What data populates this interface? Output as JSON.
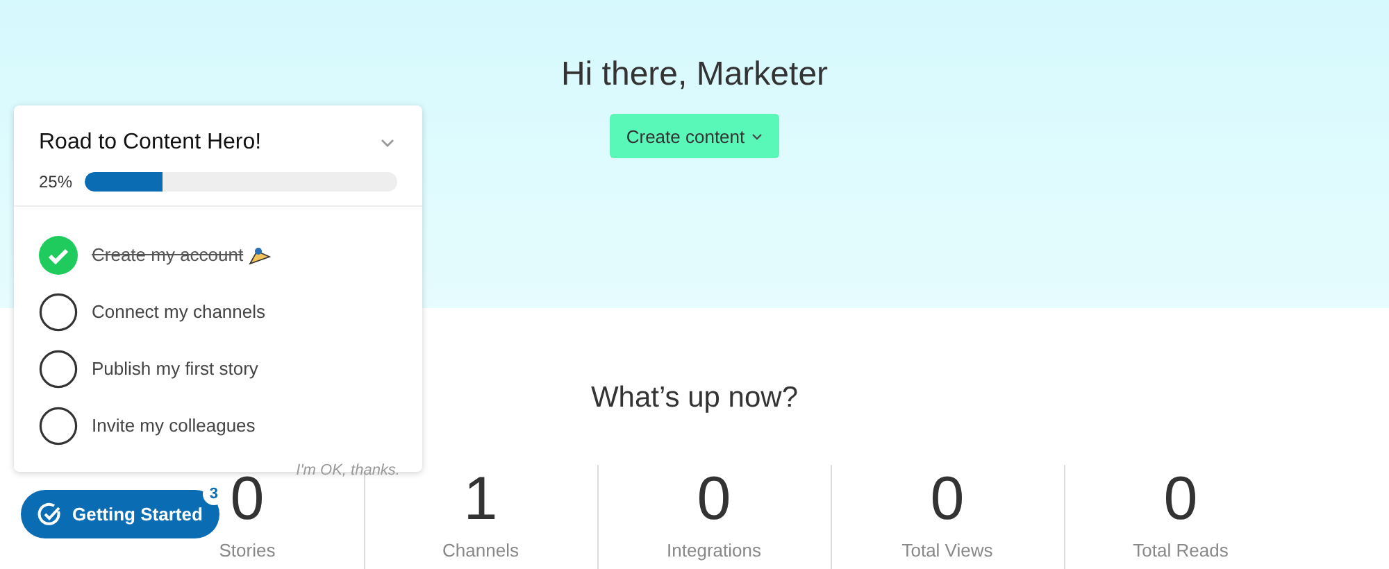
{
  "hero": {
    "greeting": "Hi there, Marketer",
    "create_button": "Create content"
  },
  "stats": {
    "title": "What’s up now?",
    "items": [
      {
        "value": "0",
        "label": "Stories"
      },
      {
        "value": "1",
        "label": "Channels"
      },
      {
        "value": "0",
        "label": "Integrations"
      },
      {
        "value": "0",
        "label": "Total Views"
      },
      {
        "value": "0",
        "label": "Total Reads"
      }
    ]
  },
  "checklist": {
    "title": "Road to Content Hero!",
    "expanded": true,
    "progress_text": "25%",
    "level": 0.25,
    "tasks": [
      {
        "label": "Create my account",
        "done": true
      },
      {
        "label": "Connect my channels",
        "done": false
      },
      {
        "label": "Publish my first story",
        "done": false
      },
      {
        "label": "Invite my colleagues",
        "done": false
      }
    ],
    "dismiss": "I'm OK, thanks."
  },
  "launcher": {
    "label": "Getting Started",
    "badge": "3"
  }
}
